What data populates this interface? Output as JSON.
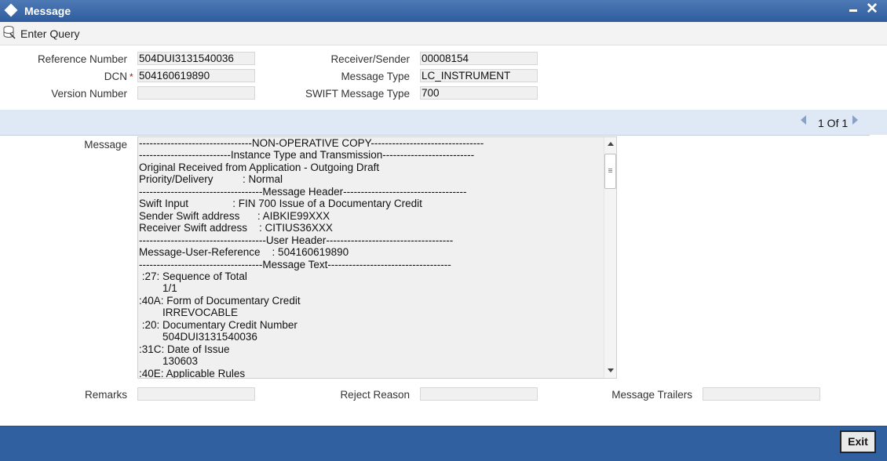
{
  "window": {
    "title": "Message",
    "icon": "diamond-icon"
  },
  "toolbar": {
    "enter_query_label": "Enter Query",
    "icon": "enter-query-icon"
  },
  "form": {
    "reference_number": {
      "label": "Reference Number",
      "value": "504DUI3131540036"
    },
    "dcn": {
      "label": "DCN",
      "required_mark": "*",
      "value": "504160619890"
    },
    "version_number": {
      "label": "Version Number",
      "value": ""
    },
    "receiver_sender": {
      "label": "Receiver/Sender",
      "value": "00008154"
    },
    "message_type": {
      "label": "Message Type",
      "value": "LC_INSTRUMENT"
    },
    "swift_message_type": {
      "label": "SWIFT Message Type",
      "value": "700"
    }
  },
  "pager": {
    "text": "1 Of 1"
  },
  "message": {
    "label": "Message",
    "lines": [
      "--------------------------------NON-OPERATIVE COPY--------------------------------",
      "--------------------------Instance Type and Transmission--------------------------",
      "Original Received from Application - Outgoing Draft",
      "Priority/Delivery          : Normal",
      "-----------------------------------Message Header-----------------------------------",
      "Swift Input               : FIN 700 Issue of a Documentary Credit",
      "Sender Swift address      : AIBKIE99XXX",
      "Receiver Swift address    : CITIUS36XXX",
      "------------------------------------User Header------------------------------------",
      "Message-User-Reference    : 504160619890",
      "-----------------------------------Message Text-----------------------------------",
      " :27: Sequence of Total",
      "        1/1",
      ":40A: Form of Documentary Credit",
      "        IRREVOCABLE",
      " :20: Documentary Credit Number",
      "        504DUI3131540036",
      ":31C: Date of Issue",
      "        130603",
      ":40E: Applicable Rules"
    ]
  },
  "bottom_fields": {
    "remarks": {
      "label": "Remarks",
      "value": ""
    },
    "reject_reason": {
      "label": "Reject Reason",
      "value": ""
    },
    "message_trailers": {
      "label": "Message Trailers",
      "value": ""
    }
  },
  "footer": {
    "exit_label": "Exit"
  }
}
